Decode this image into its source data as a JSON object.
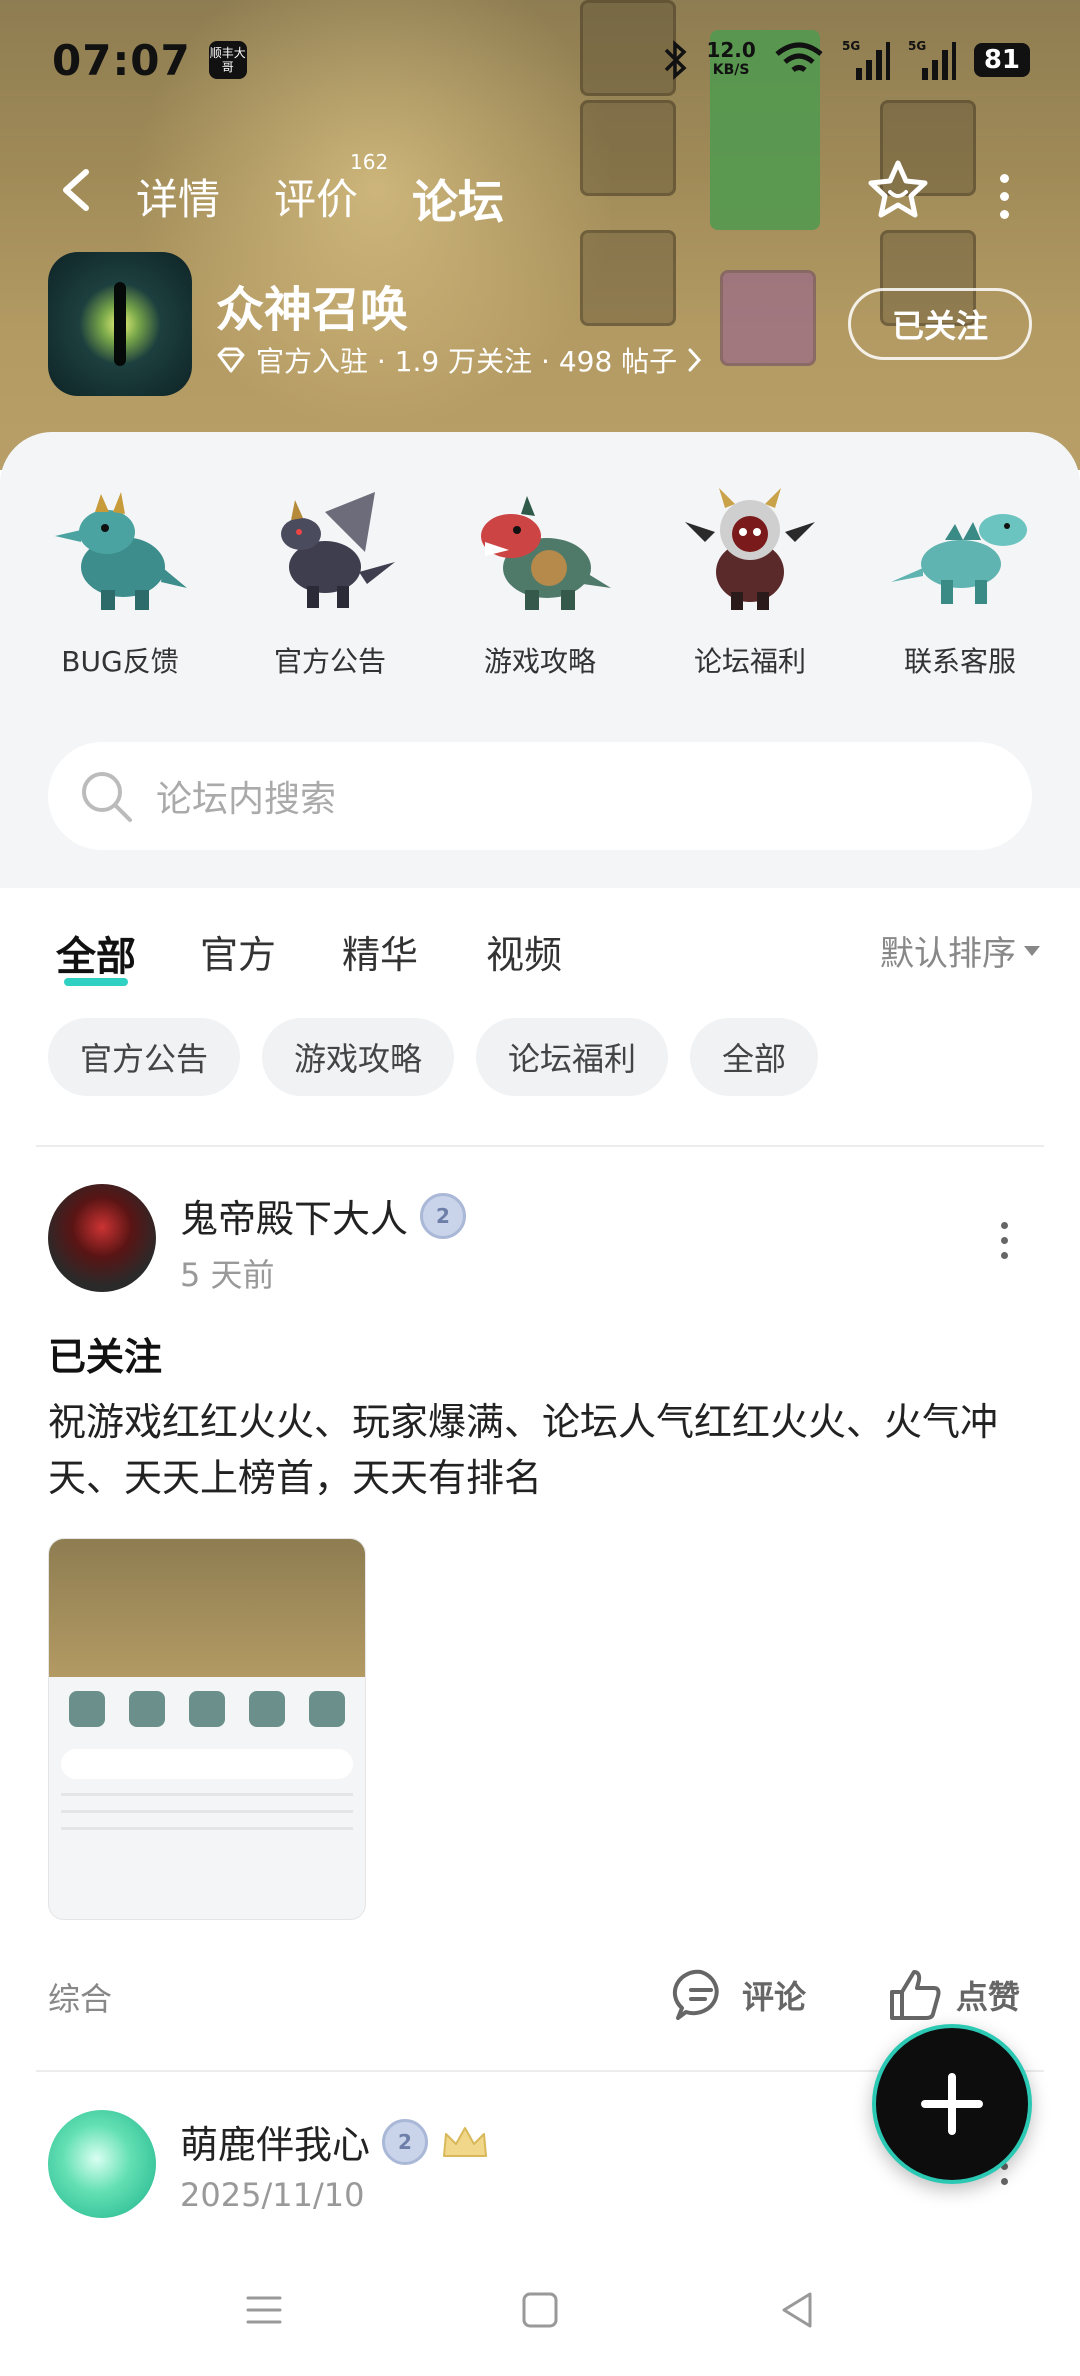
{
  "status_bar": {
    "time": "07:07",
    "app_badge": "顺丰大哥",
    "net_speed": "12.0",
    "net_unit": "KB/S",
    "battery": "81"
  },
  "nav": {
    "tabs": [
      "详情",
      "评价",
      "论坛"
    ],
    "rating_count": "162",
    "active_tab": "论坛"
  },
  "game": {
    "title": "众神召唤",
    "meta": "官方入驻 · 1.9 万关注 · 498 帖子",
    "follow_label": "已关注"
  },
  "categories": [
    {
      "label": "BUG反馈",
      "icon": "blue-dragon-icon"
    },
    {
      "label": "官方公告",
      "icon": "dark-dragon-icon"
    },
    {
      "label": "游戏攻略",
      "icon": "armored-dragon-icon"
    },
    {
      "label": "论坛福利",
      "icon": "demon-icon"
    },
    {
      "label": "联系客服",
      "icon": "teal-dragon-icon"
    }
  ],
  "search": {
    "placeholder": "论坛内搜索"
  },
  "tabs": {
    "items": [
      "全部",
      "官方",
      "精华",
      "视频"
    ],
    "sort_label": "默认排序"
  },
  "chips": [
    "官方公告",
    "游戏攻略",
    "论坛福利",
    "全部"
  ],
  "posts": [
    {
      "author": "鬼帝殿下大人",
      "level": "2",
      "time": "5 天前",
      "title": "已关注",
      "body": "祝游戏红红火火、玩家爆满、论坛人气红红火火、火气冲天、天天上榜首，天天有排名",
      "tag": "综合",
      "comment_label": "评论",
      "like_label": "点赞"
    },
    {
      "author": "萌鹿伴我心",
      "level": "2",
      "time": "2025/11/10"
    }
  ],
  "colors": {
    "accent": "#2fd2c2",
    "hero_bg": "#a08b58",
    "panel_bg": "#f4f5f7"
  }
}
